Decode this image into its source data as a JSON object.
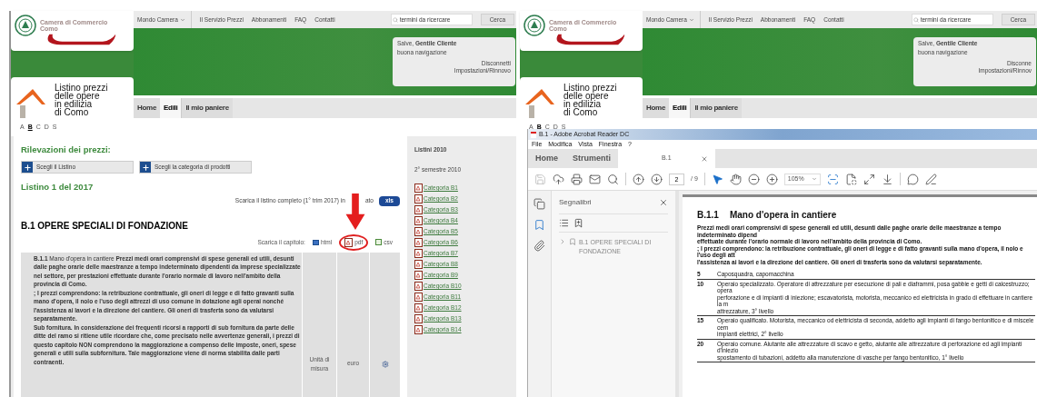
{
  "left": {
    "header": {
      "org_name": "Camera di Commercio",
      "org_city": "Como",
      "nav": [
        {
          "label": "Mondo Camera",
          "dropdown": true
        },
        {
          "label": "Il Servizio Prezzi",
          "dropdown": false
        },
        {
          "label": "Abbonamenti",
          "dropdown": false
        },
        {
          "label": "FAQ",
          "dropdown": false
        },
        {
          "label": "Contatti",
          "dropdown": false
        }
      ],
      "search": {
        "placeholder": "termini da ricercare"
      },
      "search_button": "Cerca",
      "greeting": "Salve, **Gentile Cliente**",
      "greeting_sub": "buona navigazione",
      "account_links": [
        "Disconnetti",
        "Impostazioni/Rinnovo"
      ],
      "product_title": [
        "Listino prezzi",
        "delle opere",
        "in edilizia",
        "di Como"
      ],
      "tabs": [
        {
          "label": "Home",
          "selected": false
        },
        {
          "label": "Edili",
          "selected": true
        },
        {
          "label": "Il mio paniere",
          "selected": false
        }
      ],
      "letters": [
        {
          "label": "A",
          "selected": false
        },
        {
          "label": "B",
          "selected": true
        },
        {
          "label": "C",
          "selected": false
        },
        {
          "label": "D",
          "selected": false
        },
        {
          "label": "S",
          "selected": false
        }
      ]
    },
    "main": {
      "title": "Rilevazioni dei prezzi:",
      "buttons": [
        "Scegli il Listino",
        "Scegli la categoria di prodotti"
      ],
      "listino": "Listino 1 del 2017",
      "download_text": "Scarica il listino completo (1° trim 2017) in",
      "download_text_end": "ato",
      "download_button": "xls",
      "section": "B.1 OPERE SPECIALI DI FONDAZIONE",
      "chapter_label": "Scarica il capitolo:",
      "chapter_links": [
        {
          "kind": "html",
          "label": "html",
          "circled": false
        },
        {
          "kind": "pdf",
          "label": "pdf",
          "circled": true
        },
        {
          "kind": "csv",
          "label": "csv",
          "circled": false
        }
      ],
      "row": {
        "description": [
          "**B.1.1** Mano d'opera in cantiere **Prezzi medi orari comprensivi di spese generali ed utili, desunti dalle paghe orarie delle maestranze a tempo indeterminato dipendenti da imprese specializzate nel settore, per prestazioni effettuate durante l'orario normale di lavoro nell'ambito della provincia di Como.**",
          "; I prezzi comprendono: la retribuzione contrattuale, gli oneri di legge e di fatto gravanti sulla mano d'opera, il nolo e l'uso degli attrezzi di uso comune in dotazione agli operai nonché l'assistenza ai lavori e la direzione del cantiere. Gli oneri di trasferta sono da valutarsi separatamente.",
          "Sub fornitura. In considerazione dei frequenti ricorsi a rapporti di sub fornitura da parte delle ditte del ramo si ritiene utile ricordare che, come precisato nelle avvertenze generali, i prezzi di questo capitolo NON comprendono la maggiorazione a compenso delle imposte, oneri, spese generali e utili sulla subfornitura. Tale maggiorazione viene di norma stabilita dalle parti contraenti."
        ],
        "unit": "Unità di misura",
        "currency": "euro"
      }
    },
    "sidebar": {
      "title": "Listini 2010",
      "period": "2° semestre 2010",
      "categories": [
        "Categoria B1",
        "Categoria B2",
        "Categoria B3",
        "Categoria B4",
        "Categoria B5",
        "Categoria B6",
        "Categoria B7",
        "Categoria B8",
        "Categoria B9",
        "Categoria B10",
        "Categoria B11",
        "Categoria B12",
        "Categoria B13",
        "Categoria B14"
      ]
    }
  },
  "right": {
    "header": {
      "org_name": "Camera di Commercio",
      "org_city": "Como",
      "nav": [
        {
          "label": "Mondo Camera",
          "dropdown": true
        },
        {
          "label": "Il Servizio Prezzi",
          "dropdown": false
        },
        {
          "label": "Abbonamenti",
          "dropdown": false
        },
        {
          "label": "FAQ",
          "dropdown": false
        },
        {
          "label": "Contatti",
          "dropdown": false
        }
      ],
      "search": {
        "placeholder": "termini da ricercare"
      },
      "search_button": "Cerca",
      "greeting": "Salve, **Gentile Cliente**",
      "greeting_sub": "buona navigazione",
      "account_links": [
        "Disconne",
        "Impostazioni/Rinnov"
      ],
      "product_title": [
        "Listino prezzi",
        "delle opere",
        "in edilizia",
        "di Como"
      ],
      "tabs": [
        {
          "label": "Home",
          "selected": false
        },
        {
          "label": "Edili",
          "selected": true
        },
        {
          "label": "Il mio paniere",
          "selected": false
        }
      ],
      "letters": [
        {
          "label": "A",
          "selected": false
        },
        {
          "label": "B",
          "selected": true
        },
        {
          "label": "C",
          "selected": false
        },
        {
          "label": "D",
          "selected": false
        },
        {
          "label": "S",
          "selected": false
        }
      ]
    },
    "acrobat": {
      "title": "B.1 - Adobe Acrobat Reader DC",
      "menu": [
        "File",
        "Modifica",
        "Vista",
        "Finestra",
        "?"
      ],
      "tabs": [
        {
          "label": "Home",
          "selected": false,
          "kind": "nav"
        },
        {
          "label": "Strumenti",
          "selected": false,
          "kind": "nav"
        },
        {
          "label": "B.1",
          "selected": true,
          "kind": "document"
        }
      ],
      "page": "2",
      "page_total": "/ 9",
      "zoom": "105%",
      "bookmarks": {
        "title": "Segnalibri",
        "items": [
          {
            "label": "B.1 OPERE SPECIALI DI FONDAZIONE",
            "expanded": false
          }
        ]
      },
      "document": {
        "number": "B.1.1",
        "title": "Mano d'opera in cantiere",
        "intro": [
          "Prezzi medi orari comprensivi di spese generali ed utili, desunti dalle paghe orarie delle maestranze a tempo indeterminato dipend",
          "effettuate durante l'orario normale di lavoro nell'ambito della provincia di Como.",
          "; I prezzi comprendono: la retribuzione contrattuale, gli oneri di legge e di fatto gravanti sulla mano d'opera, il nolo e l'uso degli att",
          "l'assistenza ai lavori e la direzione del cantiere. Gli oneri di trasferta sono da valutarsi separatamente."
        ],
        "rows": [
          {
            "code": "5",
            "lines": [
              "Caposquadra, capomacchina"
            ]
          },
          {
            "code": "10",
            "lines": [
              "Operaio specializzato. Operatore di attrezzature per esecuzione di pali e diaframmi, posa gabbie e getti di calcestruzzo; opera",
              "perforazione e di impianti di iniezione; escavatorista, motorista, meccanico ed elettricista in grado di effettuare in cantiere la m",
              "attrezzature, 3° livello"
            ]
          },
          {
            "code": "15",
            "lines": [
              "Operaio qualificato. Motorista, meccanico od elettricista di seconda, addetto agli impianti di fango bentonitico e di miscele cem",
              "impianti elettrici, 2° livello"
            ]
          },
          {
            "code": "20",
            "lines": [
              "Operaio comune. Aiutante alle attrezzature di scavo e getto, aiutante alle attrezzature di perforazione ed agli impianti d'iniezio",
              "spostamento di tubazioni, addetto alla manutenzione di vasche per fango bentonitico, 1° livello"
            ]
          }
        ]
      }
    }
  }
}
